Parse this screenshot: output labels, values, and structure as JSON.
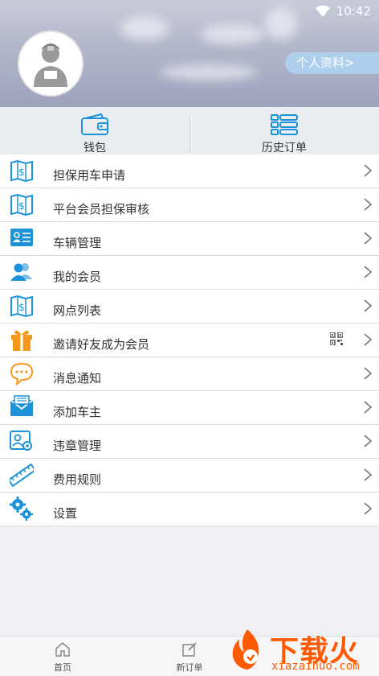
{
  "status": {
    "time": "10:42"
  },
  "header": {
    "profile_label": "个人资料>"
  },
  "quick_actions": [
    {
      "label": "钱包",
      "icon": "wallet-icon"
    },
    {
      "label": "历史订单",
      "icon": "order-list-icon"
    }
  ],
  "menu": [
    {
      "label": "担保用车申请",
      "icon": "map-dollar-icon"
    },
    {
      "label": "平台会员担保审核",
      "icon": "map-dollar-icon"
    },
    {
      "label": "车辆管理",
      "icon": "id-card-icon"
    },
    {
      "label": "我的会员",
      "icon": "members-icon"
    },
    {
      "label": "网点列表",
      "icon": "map-dollar-icon"
    },
    {
      "label": "邀请好友成为会员",
      "icon": "gift-icon"
    },
    {
      "label": "消息通知",
      "icon": "chat-bubble-icon"
    },
    {
      "label": "添加车主",
      "icon": "envelope-icon"
    },
    {
      "label": "违章管理",
      "icon": "profile-settings-icon"
    },
    {
      "label": "费用规则",
      "icon": "ruler-icon"
    },
    {
      "label": "设置",
      "icon": "gears-icon"
    }
  ],
  "tabbar": [
    {
      "label": "首页",
      "icon": "home-icon"
    },
    {
      "label": "新订单",
      "icon": "edit-icon"
    }
  ],
  "watermark": {
    "brand": "下载火",
    "url": "xiazaihuo.com"
  },
  "colors": {
    "accent": "#1c93d8",
    "orange": "#f39a1e",
    "watermark": "#ff5a00"
  }
}
